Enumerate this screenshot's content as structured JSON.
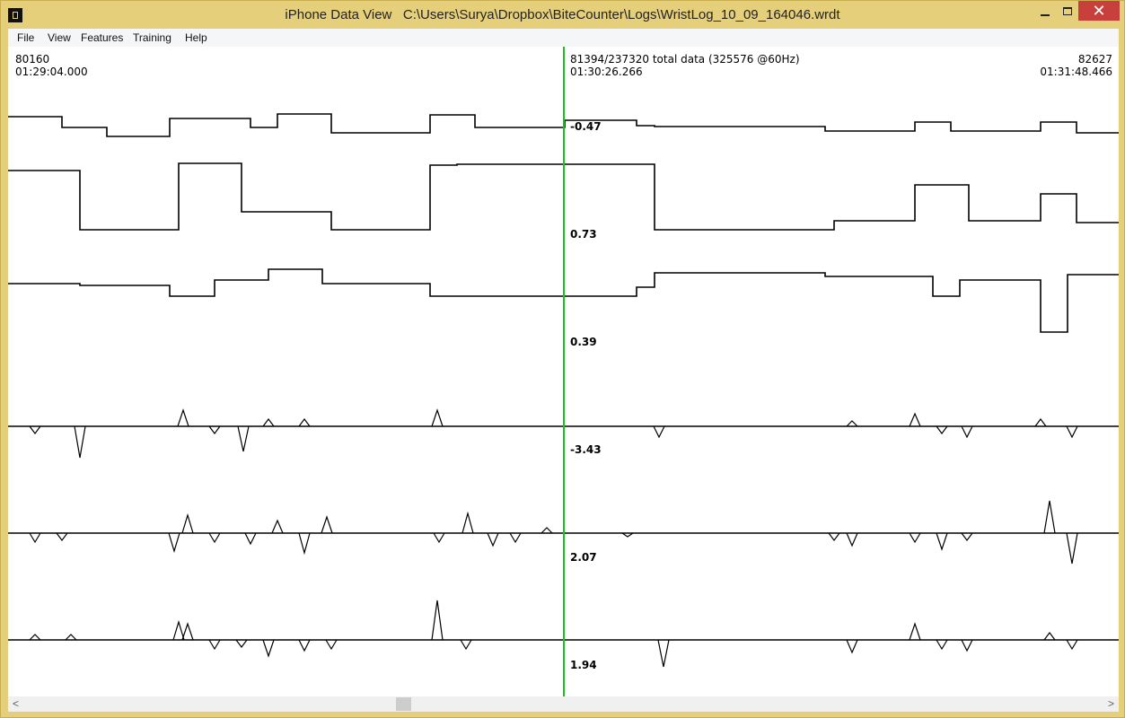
{
  "window": {
    "title": "iPhone Data View   C:\\Users\\Surya\\Dropbox\\BiteCounter\\Logs\\WristLog_10_09_164046.wrdt",
    "controls": {
      "minimize": "—",
      "maximize": "☐",
      "close": "✕"
    }
  },
  "menu": [
    "File",
    "View",
    "Features",
    "Training",
    "Help"
  ],
  "header": {
    "left_index": "80160",
    "left_time": "01:29:04.000",
    "center_info": "81394/237320 total data (325576 @60Hz)",
    "center_time": "01:30:26.266",
    "right_index": "82627",
    "right_time": "01:31:48.466"
  },
  "channels": [
    "-0.47",
    "0.73",
    "0.39",
    "-3.43",
    "2.07",
    "1.94"
  ],
  "scrollbar": {
    "left_arrow": "<",
    "right_arrow": ">",
    "position": 0.35
  },
  "colors": {
    "cursor": "#21c021",
    "trace": "#000000",
    "window_frame": "#e6cf7a",
    "close_button": "#c7403c"
  }
}
